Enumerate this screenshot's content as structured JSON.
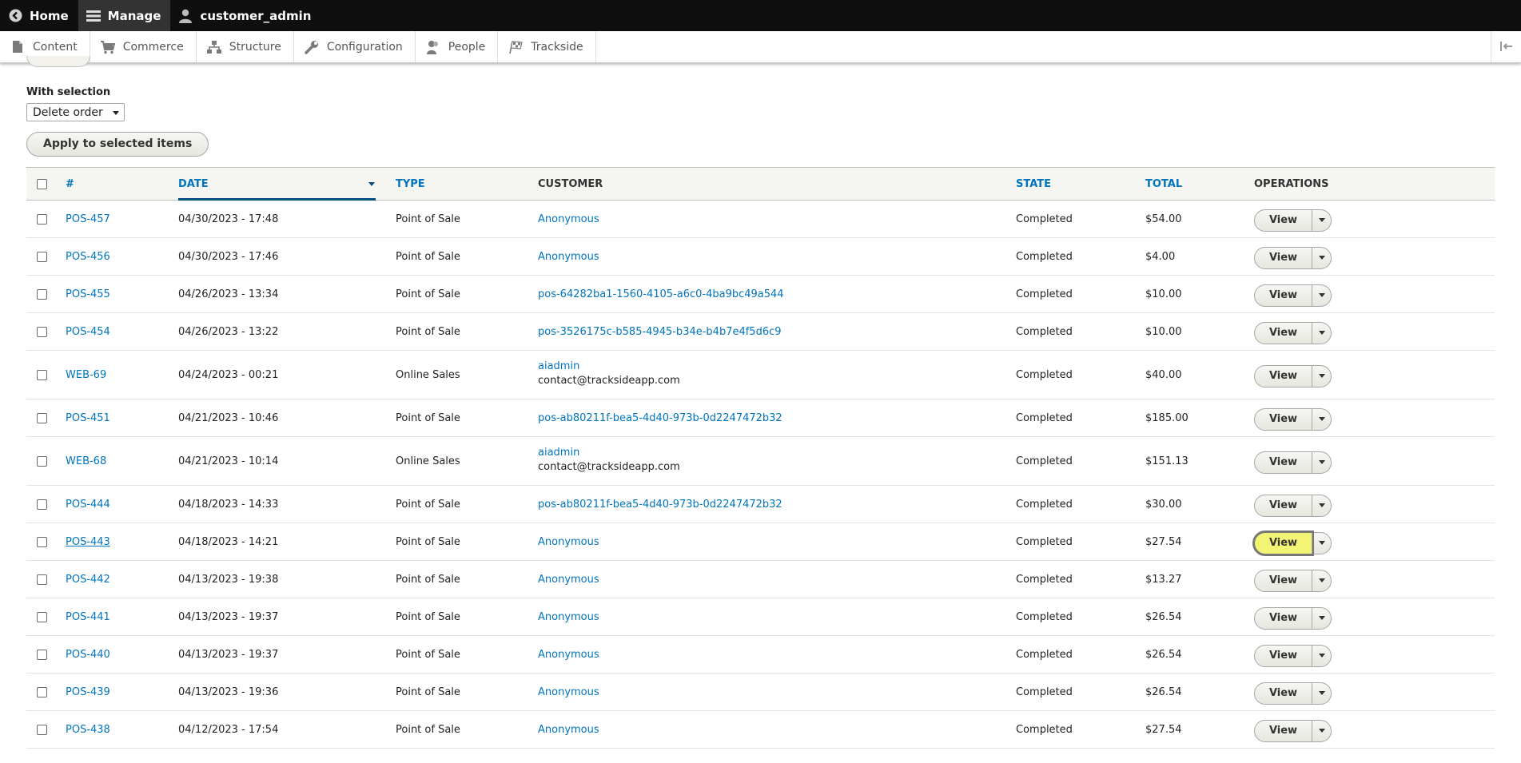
{
  "toolbar": {
    "home": "Home",
    "manage": "Manage",
    "user": "customer_admin"
  },
  "tray": {
    "items": [
      {
        "label": "Content",
        "icon": "document-icon"
      },
      {
        "label": "Commerce",
        "icon": "cart-icon"
      },
      {
        "label": "Structure",
        "icon": "structure-icon"
      },
      {
        "label": "Configuration",
        "icon": "wrench-icon"
      },
      {
        "label": "People",
        "icon": "people-icon"
      },
      {
        "label": "Trackside",
        "icon": "checkered-flag-icon"
      }
    ]
  },
  "bulk": {
    "label": "With selection",
    "selected_action": "Delete order",
    "apply_label": "Apply to selected items"
  },
  "table": {
    "headers": {
      "number": "#",
      "date": "Date",
      "type": "Type",
      "customer": "Customer",
      "state": "State",
      "total": "Total",
      "operations": "Operations"
    },
    "view_label": "View",
    "rows": [
      {
        "number": "POS-457",
        "date": "04/30/2023 - 17:48",
        "type": "Point of Sale",
        "customer": "Anonymous",
        "email": "",
        "state": "Completed",
        "total": "$54.00"
      },
      {
        "number": "POS-456",
        "date": "04/30/2023 - 17:46",
        "type": "Point of Sale",
        "customer": "Anonymous",
        "email": "",
        "state": "Completed",
        "total": "$4.00"
      },
      {
        "number": "POS-455",
        "date": "04/26/2023 - 13:34",
        "type": "Point of Sale",
        "customer": "pos-64282ba1-1560-4105-a6c0-4ba9bc49a544",
        "email": "",
        "state": "Completed",
        "total": "$10.00"
      },
      {
        "number": "POS-454",
        "date": "04/26/2023 - 13:22",
        "type": "Point of Sale",
        "customer": "pos-3526175c-b585-4945-b34e-b4b7e4f5d6c9",
        "email": "",
        "state": "Completed",
        "total": "$10.00"
      },
      {
        "number": "WEB-69",
        "date": "04/24/2023 - 00:21",
        "type": "Online Sales",
        "customer": "aiadmin",
        "email": "contact@tracksideapp.com",
        "state": "Completed",
        "total": "$40.00"
      },
      {
        "number": "POS-451",
        "date": "04/21/2023 - 10:46",
        "type": "Point of Sale",
        "customer": "pos-ab80211f-bea5-4d40-973b-0d2247472b32",
        "email": "",
        "state": "Completed",
        "total": "$185.00"
      },
      {
        "number": "WEB-68",
        "date": "04/21/2023 - 10:14",
        "type": "Online Sales",
        "customer": "aiadmin",
        "email": "contact@tracksideapp.com",
        "state": "Completed",
        "total": "$151.13"
      },
      {
        "number": "POS-444",
        "date": "04/18/2023 - 14:33",
        "type": "Point of Sale",
        "customer": "pos-ab80211f-bea5-4d40-973b-0d2247472b32",
        "email": "",
        "state": "Completed",
        "total": "$30.00"
      },
      {
        "number": "POS-443",
        "date": "04/18/2023 - 14:21",
        "type": "Point of Sale",
        "customer": "Anonymous",
        "email": "",
        "state": "Completed",
        "total": "$27.54"
      },
      {
        "number": "POS-442",
        "date": "04/13/2023 - 19:38",
        "type": "Point of Sale",
        "customer": "Anonymous",
        "email": "",
        "state": "Completed",
        "total": "$13.27"
      },
      {
        "number": "POS-441",
        "date": "04/13/2023 - 19:37",
        "type": "Point of Sale",
        "customer": "Anonymous",
        "email": "",
        "state": "Completed",
        "total": "$26.54"
      },
      {
        "number": "POS-440",
        "date": "04/13/2023 - 19:37",
        "type": "Point of Sale",
        "customer": "Anonymous",
        "email": "",
        "state": "Completed",
        "total": "$26.54"
      },
      {
        "number": "POS-439",
        "date": "04/13/2023 - 19:36",
        "type": "Point of Sale",
        "customer": "Anonymous",
        "email": "",
        "state": "Completed",
        "total": "$26.54"
      },
      {
        "number": "POS-438",
        "date": "04/12/2023 - 17:54",
        "type": "Point of Sale",
        "customer": "Anonymous",
        "email": "",
        "state": "Completed",
        "total": "$27.54"
      }
    ]
  }
}
